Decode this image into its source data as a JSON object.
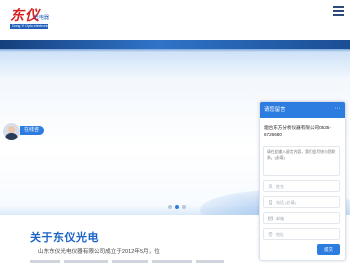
{
  "header": {
    "logo_cn": "东仪",
    "logo_sub": "光电器",
    "logo_band": "Dong Yi Opto-electronics",
    "menu_icon": "hamburger-menu-icon"
  },
  "banner": {
    "slide_count": 3,
    "active_slide": 2
  },
  "chat": {
    "label": "在线咨询",
    "avatar_icon": "agent-avatar-icon"
  },
  "about": {
    "title": "关于东仪光电",
    "text": "山东东仪光电仪器有限公司成立于2012年5月，位"
  },
  "message_panel": {
    "title": "请您留言",
    "more_icon": "ellipsis-icon",
    "company_line": "烟台东方分析仪器有限公司0535-6726680",
    "content_placeholder": "请在此输入留言内容，我们会尽快与您联系。(必填)",
    "name_placeholder": "姓名",
    "phone_placeholder": "电话 (必填)",
    "email_placeholder": "邮箱",
    "address_placeholder": "地址",
    "submit_label": "提交"
  },
  "colors": {
    "accent": "#2d7ce0",
    "title_blue": "#1a63c4",
    "logo_red": "#d81e1e"
  }
}
